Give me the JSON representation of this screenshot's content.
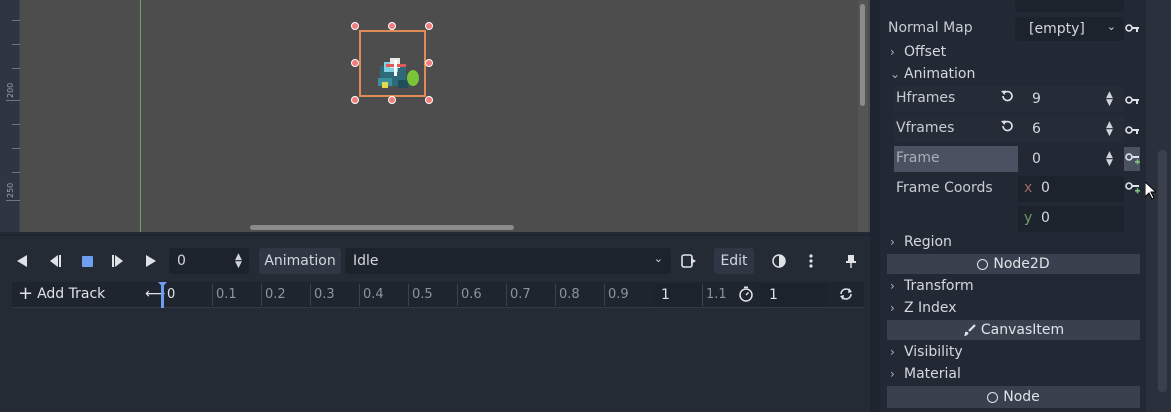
{
  "viewport": {
    "ruler_labels": [
      "200",
      "250"
    ]
  },
  "animation": {
    "frame_value": "0",
    "animation_label": "Animation",
    "animation_name": "Idle",
    "edit_label": "Edit",
    "add_track_label": "Add Track",
    "timeline_ticks": [
      "0",
      "0.1",
      "0.2",
      "0.3",
      "0.4",
      "0.5",
      "0.6",
      "0.7",
      "0.8",
      "0.9",
      "1",
      "1.1"
    ],
    "length_value": "1",
    "snap_value": "1"
  },
  "inspector": {
    "normal_map_label": "Normal Map",
    "normal_map_value": "[empty]",
    "offset_label": "Offset",
    "animation_section": "Animation",
    "hframes_label": "Hframes",
    "hframes_value": "9",
    "vframes_label": "Vframes",
    "vframes_value": "6",
    "frame_label": "Frame",
    "frame_value": "0",
    "frame_coords_label": "Frame Coords",
    "coord_x_label": "x",
    "coord_x_value": "0",
    "coord_y_label": "y",
    "coord_y_value": "0",
    "region_label": "Region",
    "node2d_header": "Node2D",
    "transform_label": "Transform",
    "zindex_label": "Z Index",
    "canvasitem_header": "CanvasItem",
    "visibility_label": "Visibility",
    "material_label": "Material",
    "node_header": "Node"
  },
  "colors": {
    "accent": "#e08a55",
    "frame_highlight": "#4a5160",
    "x_axis": "#e06c6c",
    "y_axis": "#7ac47a"
  }
}
